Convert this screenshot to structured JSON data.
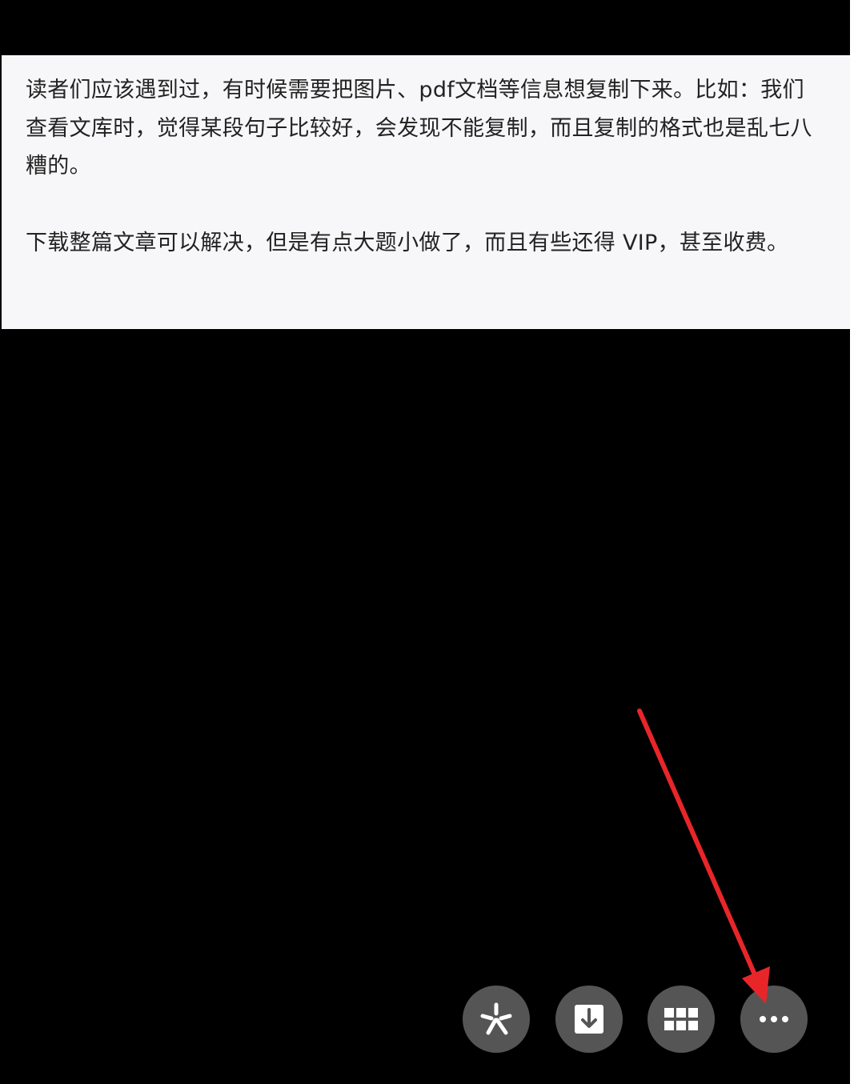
{
  "article": {
    "paragraph1": "读者们应该遇到过，有时候需要把图片、pdf文档等信息想复制下来。比如：我们查看文库时，觉得某段句子比较好，会发现不能复制，而且复制的格式也是乱七八糟的。",
    "paragraph2": "下载整篇文章可以解决，但是有点大题小做了，而且有些还得 VIP，甚至收费。"
  },
  "toolbar": {
    "buttons": [
      {
        "icon": "ai-sparkle-icon"
      },
      {
        "icon": "download-icon"
      },
      {
        "icon": "grid-icon"
      },
      {
        "icon": "more-icon"
      }
    ]
  },
  "colors": {
    "viewer_background": "#000000",
    "panel_background": "#f7f7f9",
    "button_background": "#555555",
    "arrow": "#e8262a"
  }
}
